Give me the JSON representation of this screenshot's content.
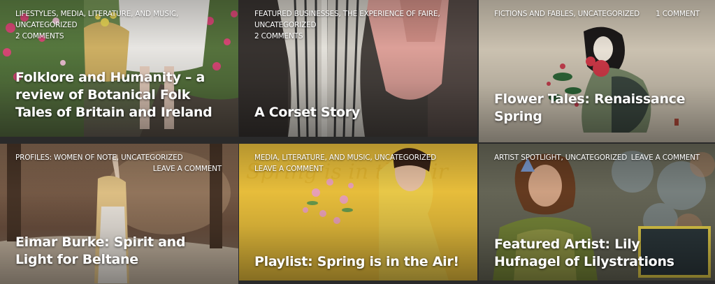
{
  "posts": [
    {
      "categories": "LIFESTYLES, MEDIA, LITERATURE, AND MUSIC, UNCATEGORIZED",
      "comments": "2 COMMENTS",
      "title": "Folklore and Humanity – a review of Botanical Folk Tales of Britain and Ireland"
    },
    {
      "categories": "FEATURED BUSINESSES, THE EXPERIENCE OF FAIRE, UNCATEGORIZED",
      "comments": "2 COMMENTS",
      "title": "A Corset Story"
    },
    {
      "categories": "FICTIONS AND FABLES, UNCATEGORIZED",
      "comments": "1 COMMENT",
      "title": "Flower Tales: Renaissance Spring"
    },
    {
      "categories": "PROFILES: WOMEN OF NOTE, UNCATEGORIZED",
      "comments": "LEAVE A COMMENT",
      "title": "Eimar Burke: Spirit and Light for Beltane"
    },
    {
      "categories": "MEDIA, LITERATURE, AND MUSIC, UNCATEGORIZED",
      "comments": "LEAVE A COMMENT",
      "title": "Playlist: Spring is in the Air!"
    },
    {
      "categories": "ARTIST SPOTLIGHT, UNCATEGORIZED",
      "comments": "LEAVE A COMMENT",
      "title": "Featured Artist: Lily Hufnagel of Lilystrations"
    }
  ],
  "colors": {
    "background": "#2a2a2a",
    "text": "#ffffff"
  }
}
